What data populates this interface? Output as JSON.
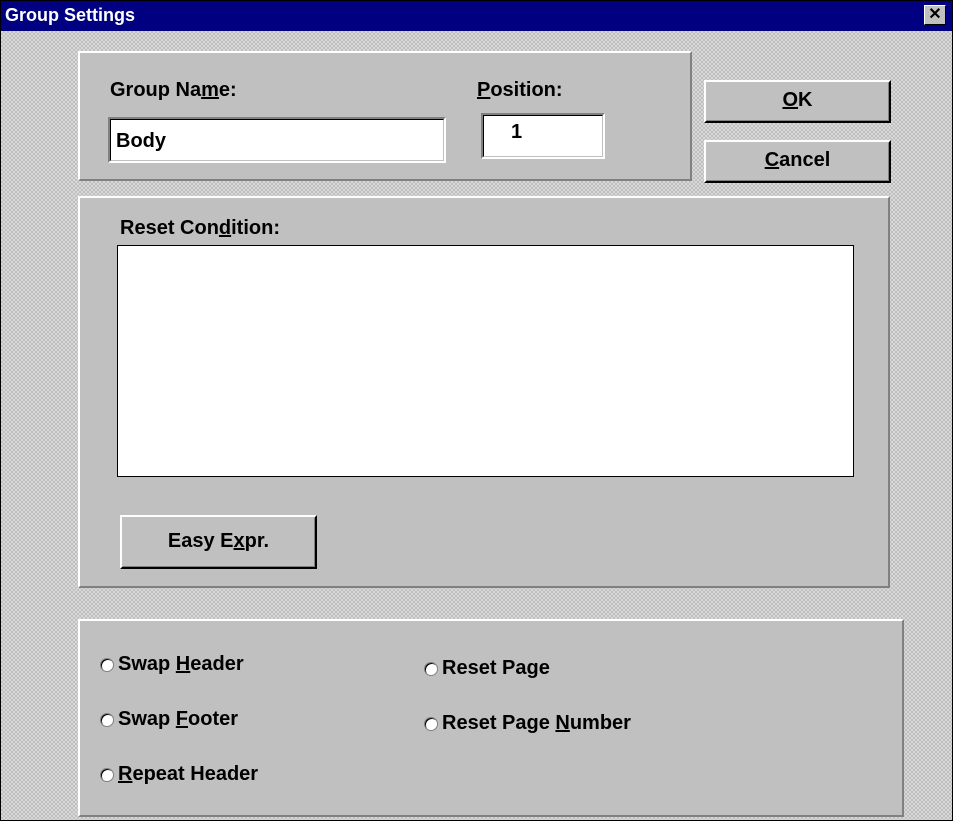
{
  "dialog": {
    "title": "Group Settings",
    "close_glyph": "✕"
  },
  "group_name": {
    "label_pre": "Group Na",
    "label_acc": "m",
    "label_post": "e:",
    "value": "Body"
  },
  "position": {
    "label_acc": "P",
    "label_post": "osition:",
    "value": "1"
  },
  "buttons": {
    "ok_acc": "O",
    "ok_post": "K",
    "cancel_acc": "C",
    "cancel_post": "ancel",
    "easy_pre": "Easy E",
    "easy_acc": "x",
    "easy_post": "pr."
  },
  "reset_condition": {
    "label_pre": "Reset Con",
    "label_acc": "d",
    "label_post": "ition:",
    "value": ""
  },
  "options": {
    "swap_header_pre": "Swap ",
    "swap_header_acc": "H",
    "swap_header_post": "eader",
    "swap_footer_pre": "Swap ",
    "swap_footer_acc": "F",
    "swap_footer_post": "ooter",
    "repeat_header_acc": "R",
    "repeat_header_post": "epeat Header",
    "reset_page": "Reset Page",
    "reset_page_number_pre": "Reset Page ",
    "reset_page_number_acc": "N",
    "reset_page_number_post": "umber"
  }
}
